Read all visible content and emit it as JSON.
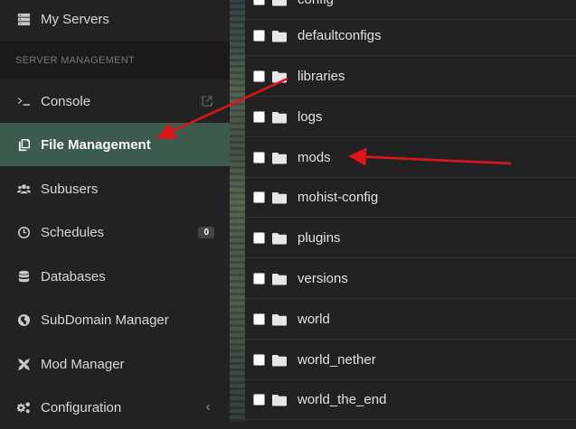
{
  "sidebar": {
    "my_servers": "My Servers",
    "section_header": "SERVER MANAGEMENT",
    "items": [
      {
        "label": "Console",
        "icon": "terminal-icon"
      },
      {
        "label": "File Management",
        "icon": "files-icon",
        "active": true
      },
      {
        "label": "Subusers",
        "icon": "users-icon"
      },
      {
        "label": "Schedules",
        "icon": "clock-icon",
        "badge": "0"
      },
      {
        "label": "Databases",
        "icon": "database-icon"
      },
      {
        "label": "SubDomain Manager",
        "icon": "globe-icon"
      },
      {
        "label": "Mod Manager",
        "icon": "mod-icon"
      },
      {
        "label": "Configuration",
        "icon": "cogs-icon",
        "chevron": "‹"
      }
    ]
  },
  "files": {
    "partial_top": "config",
    "rows": [
      "defaultconfigs",
      "libraries",
      "logs",
      "mods",
      "mohist-config",
      "plugins",
      "versions",
      "world",
      "world_nether",
      "world_the_end"
    ]
  },
  "colors": {
    "active_bg": "#3d5a4f",
    "arrow": "#e0151b",
    "bg": "#222222"
  }
}
